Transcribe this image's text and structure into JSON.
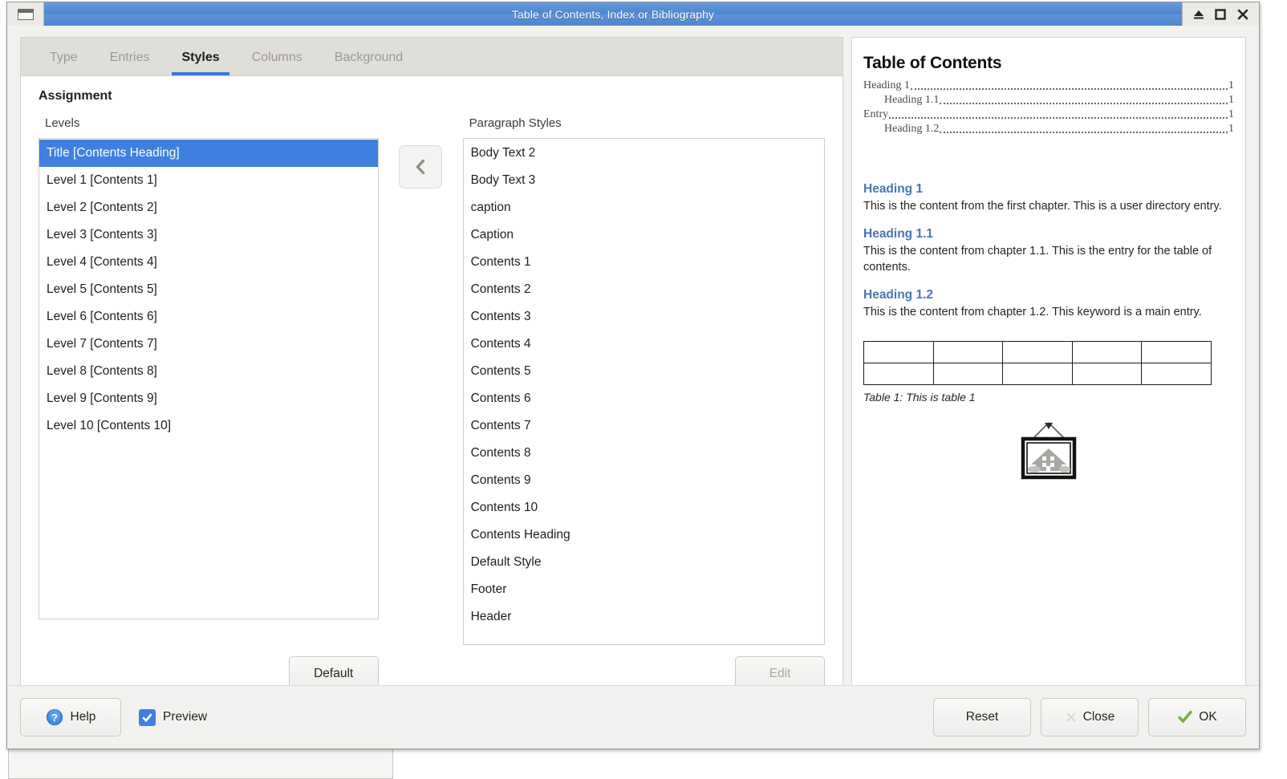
{
  "window": {
    "title": "Table of Contents, Index or Bibliography",
    "controls": [
      {
        "name": "minimize-icon",
        "label": "Minimize"
      },
      {
        "name": "maximize-icon",
        "label": "Maximize"
      },
      {
        "name": "close-icon",
        "label": "Close"
      }
    ],
    "titlebar_color": "#4b83cf"
  },
  "tabs": [
    {
      "label": "Type",
      "active": false
    },
    {
      "label": "Entries",
      "active": false
    },
    {
      "label": "Styles",
      "active": true
    },
    {
      "label": "Columns",
      "active": false
    },
    {
      "label": "Background",
      "active": false
    }
  ],
  "assignment": {
    "group_label": "Assignment",
    "levels_label": "Levels",
    "styles_label": "Paragraph Styles",
    "transfer_button": "‹",
    "levels": [
      {
        "label": "Title [Contents Heading]",
        "selected": true
      },
      {
        "label": "Level 1 [Contents 1]",
        "selected": false
      },
      {
        "label": "Level 2 [Contents 2]",
        "selected": false
      },
      {
        "label": "Level 3 [Contents 3]",
        "selected": false
      },
      {
        "label": "Level 4 [Contents 4]",
        "selected": false
      },
      {
        "label": "Level 5 [Contents 5]",
        "selected": false
      },
      {
        "label": "Level 6 [Contents 6]",
        "selected": false
      },
      {
        "label": "Level 7 [Contents 7]",
        "selected": false
      },
      {
        "label": "Level 8 [Contents 8]",
        "selected": false
      },
      {
        "label": "Level 9 [Contents 9]",
        "selected": false
      },
      {
        "label": "Level 10 [Contents 10]",
        "selected": false
      }
    ],
    "paragraph_styles": [
      {
        "label": "Body Text 2"
      },
      {
        "label": "Body Text 3"
      },
      {
        "label": "caption"
      },
      {
        "label": "Caption"
      },
      {
        "label": "Contents 1"
      },
      {
        "label": "Contents 2"
      },
      {
        "label": "Contents 3"
      },
      {
        "label": "Contents 4"
      },
      {
        "label": "Contents 5"
      },
      {
        "label": "Contents 6"
      },
      {
        "label": "Contents 7"
      },
      {
        "label": "Contents 8"
      },
      {
        "label": "Contents 9"
      },
      {
        "label": "Contents 10"
      },
      {
        "label": "Contents Heading"
      },
      {
        "label": "Default Style"
      },
      {
        "label": "Footer"
      },
      {
        "label": "Header"
      }
    ],
    "default_button": "Default",
    "edit_button": "Edit",
    "edit_enabled": false,
    "selection_color": "#3f7fe0"
  },
  "preview": {
    "title": "Table of Contents",
    "toc_entries": [
      {
        "text": "Heading 1",
        "page": "1",
        "indent": false
      },
      {
        "text": "Heading 1.1",
        "page": "1",
        "indent": true
      },
      {
        "text": "Entry",
        "page": "1",
        "indent": false
      },
      {
        "text": "Heading 1.2",
        "page": "1",
        "indent": true
      }
    ],
    "sections": [
      {
        "heading": "Heading 1",
        "body": "This is the content from the first chapter. This is a user directory entry."
      },
      {
        "heading": "Heading 1.1",
        "body": "This is the content from chapter 1.1. This is the entry for the table of contents."
      },
      {
        "heading": "Heading 1.2",
        "body": "This is the content from chapter 1.2. This keyword is a main entry."
      }
    ],
    "heading_color": "#4a76ab",
    "table": {
      "rows": 2,
      "cols": 5
    },
    "table_caption": "Table 1: This is table 1",
    "image_placeholder": "framed-picture-icon"
  },
  "footer": {
    "help_label": "Help",
    "preview_label": "Preview",
    "preview_checked": true,
    "reset_label": "Reset",
    "close_label": "Close",
    "ok_label": "OK",
    "ok_accent": "#6fb23c"
  }
}
